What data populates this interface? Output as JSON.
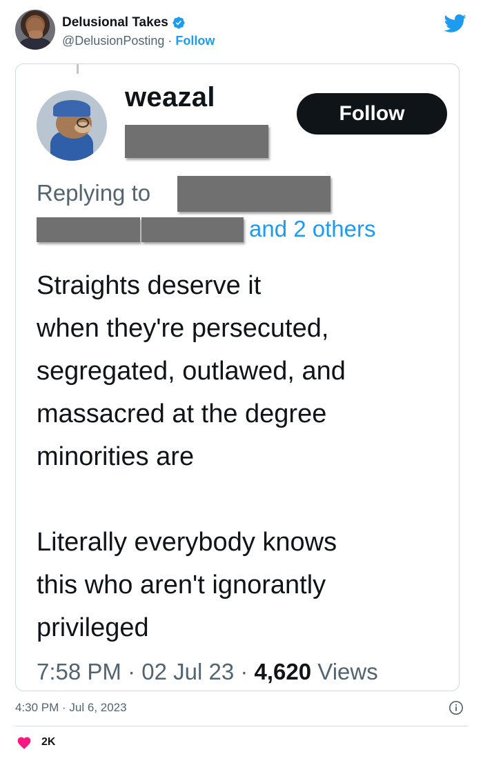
{
  "author": {
    "display_name": "Delusional Takes",
    "handle": "@DelusionPosting",
    "separator": "·",
    "follow_label": "Follow"
  },
  "embedded": {
    "username": "weazal",
    "follow_label": "Follow",
    "replying_to_label": "Replying to",
    "and_others": "and 2 others",
    "text": "Straights deserve it\nwhen they're persecuted,\nsegregated, outlawed, and\nmassacred at the degree\nminorities are\n\nLiterally everybody knows\nthis who aren't ignorantly\nprivileged",
    "time": "7:58 PM",
    "date": "02 Jul 23",
    "views_count": "4,620",
    "views_label": "Views"
  },
  "footer": {
    "timestamp": "4:30 PM · Jul 6, 2023",
    "likes": "2K"
  },
  "colors": {
    "accent": "#1d9bf0",
    "like": "#f91880",
    "muted": "#536471"
  }
}
